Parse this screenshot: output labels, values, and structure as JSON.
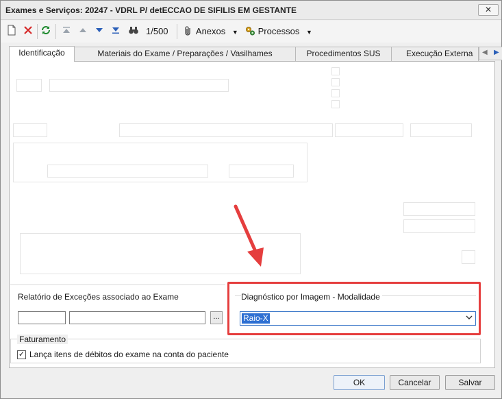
{
  "window": {
    "title": "Exames e Serviços: 20247 - VDRL P/ detECCAO DE SIFILIS EM GESTANTE",
    "close_label": "✕"
  },
  "toolbar": {
    "record_counter": "1/500",
    "attachments_label": "Anexos",
    "processes_label": "Processos"
  },
  "tabs": [
    {
      "label": "Identificação",
      "active": true
    },
    {
      "label": "Materiais do Exame / Preparações / Vasilhames",
      "active": false
    },
    {
      "label": "Procedimentos SUS",
      "active": false
    },
    {
      "label": "Execução Externa",
      "active": false
    }
  ],
  "exceptions_report": {
    "title": "Relatório de Exceções associado ao Exame",
    "code_value": "",
    "name_value": "",
    "browse_label": "..."
  },
  "imaging": {
    "title": "Diagnóstico por Imagem - Modalidade",
    "selected": "Raio-X"
  },
  "billing": {
    "title": "Faturamento",
    "checkbox_label": "Lança itens de débitos do exame na conta do paciente",
    "checked": true
  },
  "footer": {
    "ok_label": "OK",
    "cancel_label": "Cancelar",
    "save_label": "Salvar"
  },
  "colors": {
    "highlight": "#e53e3e",
    "selection": "#2d6fd2"
  }
}
